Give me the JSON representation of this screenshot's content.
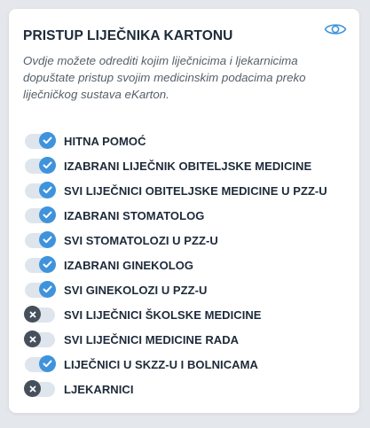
{
  "card": {
    "title": "PRISTUP LIJEČNIKA KARTONU",
    "description": "Ovdje možete odrediti kojim liječnicima i ljekarnicima dopuštate pristup svojim medicinskim podacima preko liječničkog sustava eKarton.",
    "visibility_icon": "eye-icon"
  },
  "colors": {
    "accent": "#3f93dc",
    "off_knob": "#45505c",
    "track": "#dfe5ec"
  },
  "permissions": [
    {
      "label": "HITNA POMOĆ",
      "enabled": true
    },
    {
      "label": "IZABRANI LIJEČNIK OBITELJSKE MEDICINE",
      "enabled": true
    },
    {
      "label": "SVI LIJEČNICI OBITELJSKE MEDICINE U PZZ-U",
      "enabled": true
    },
    {
      "label": "IZABRANI STOMATOLOG",
      "enabled": true
    },
    {
      "label": "SVI STOMATOLOZI U PZZ-U",
      "enabled": true
    },
    {
      "label": "IZABRANI GINEKOLOG",
      "enabled": true
    },
    {
      "label": "SVI GINEKOLOZI U PZZ-U",
      "enabled": true
    },
    {
      "label": "SVI LIJEČNICI ŠKOLSKE MEDICINE",
      "enabled": false
    },
    {
      "label": "SVI LIJEČNICI MEDICINE RADA",
      "enabled": false
    },
    {
      "label": "LIJEČNICI U SKZZ-U I BOLNICAMA",
      "enabled": true
    },
    {
      "label": "LJEKARNICI",
      "enabled": false
    }
  ]
}
